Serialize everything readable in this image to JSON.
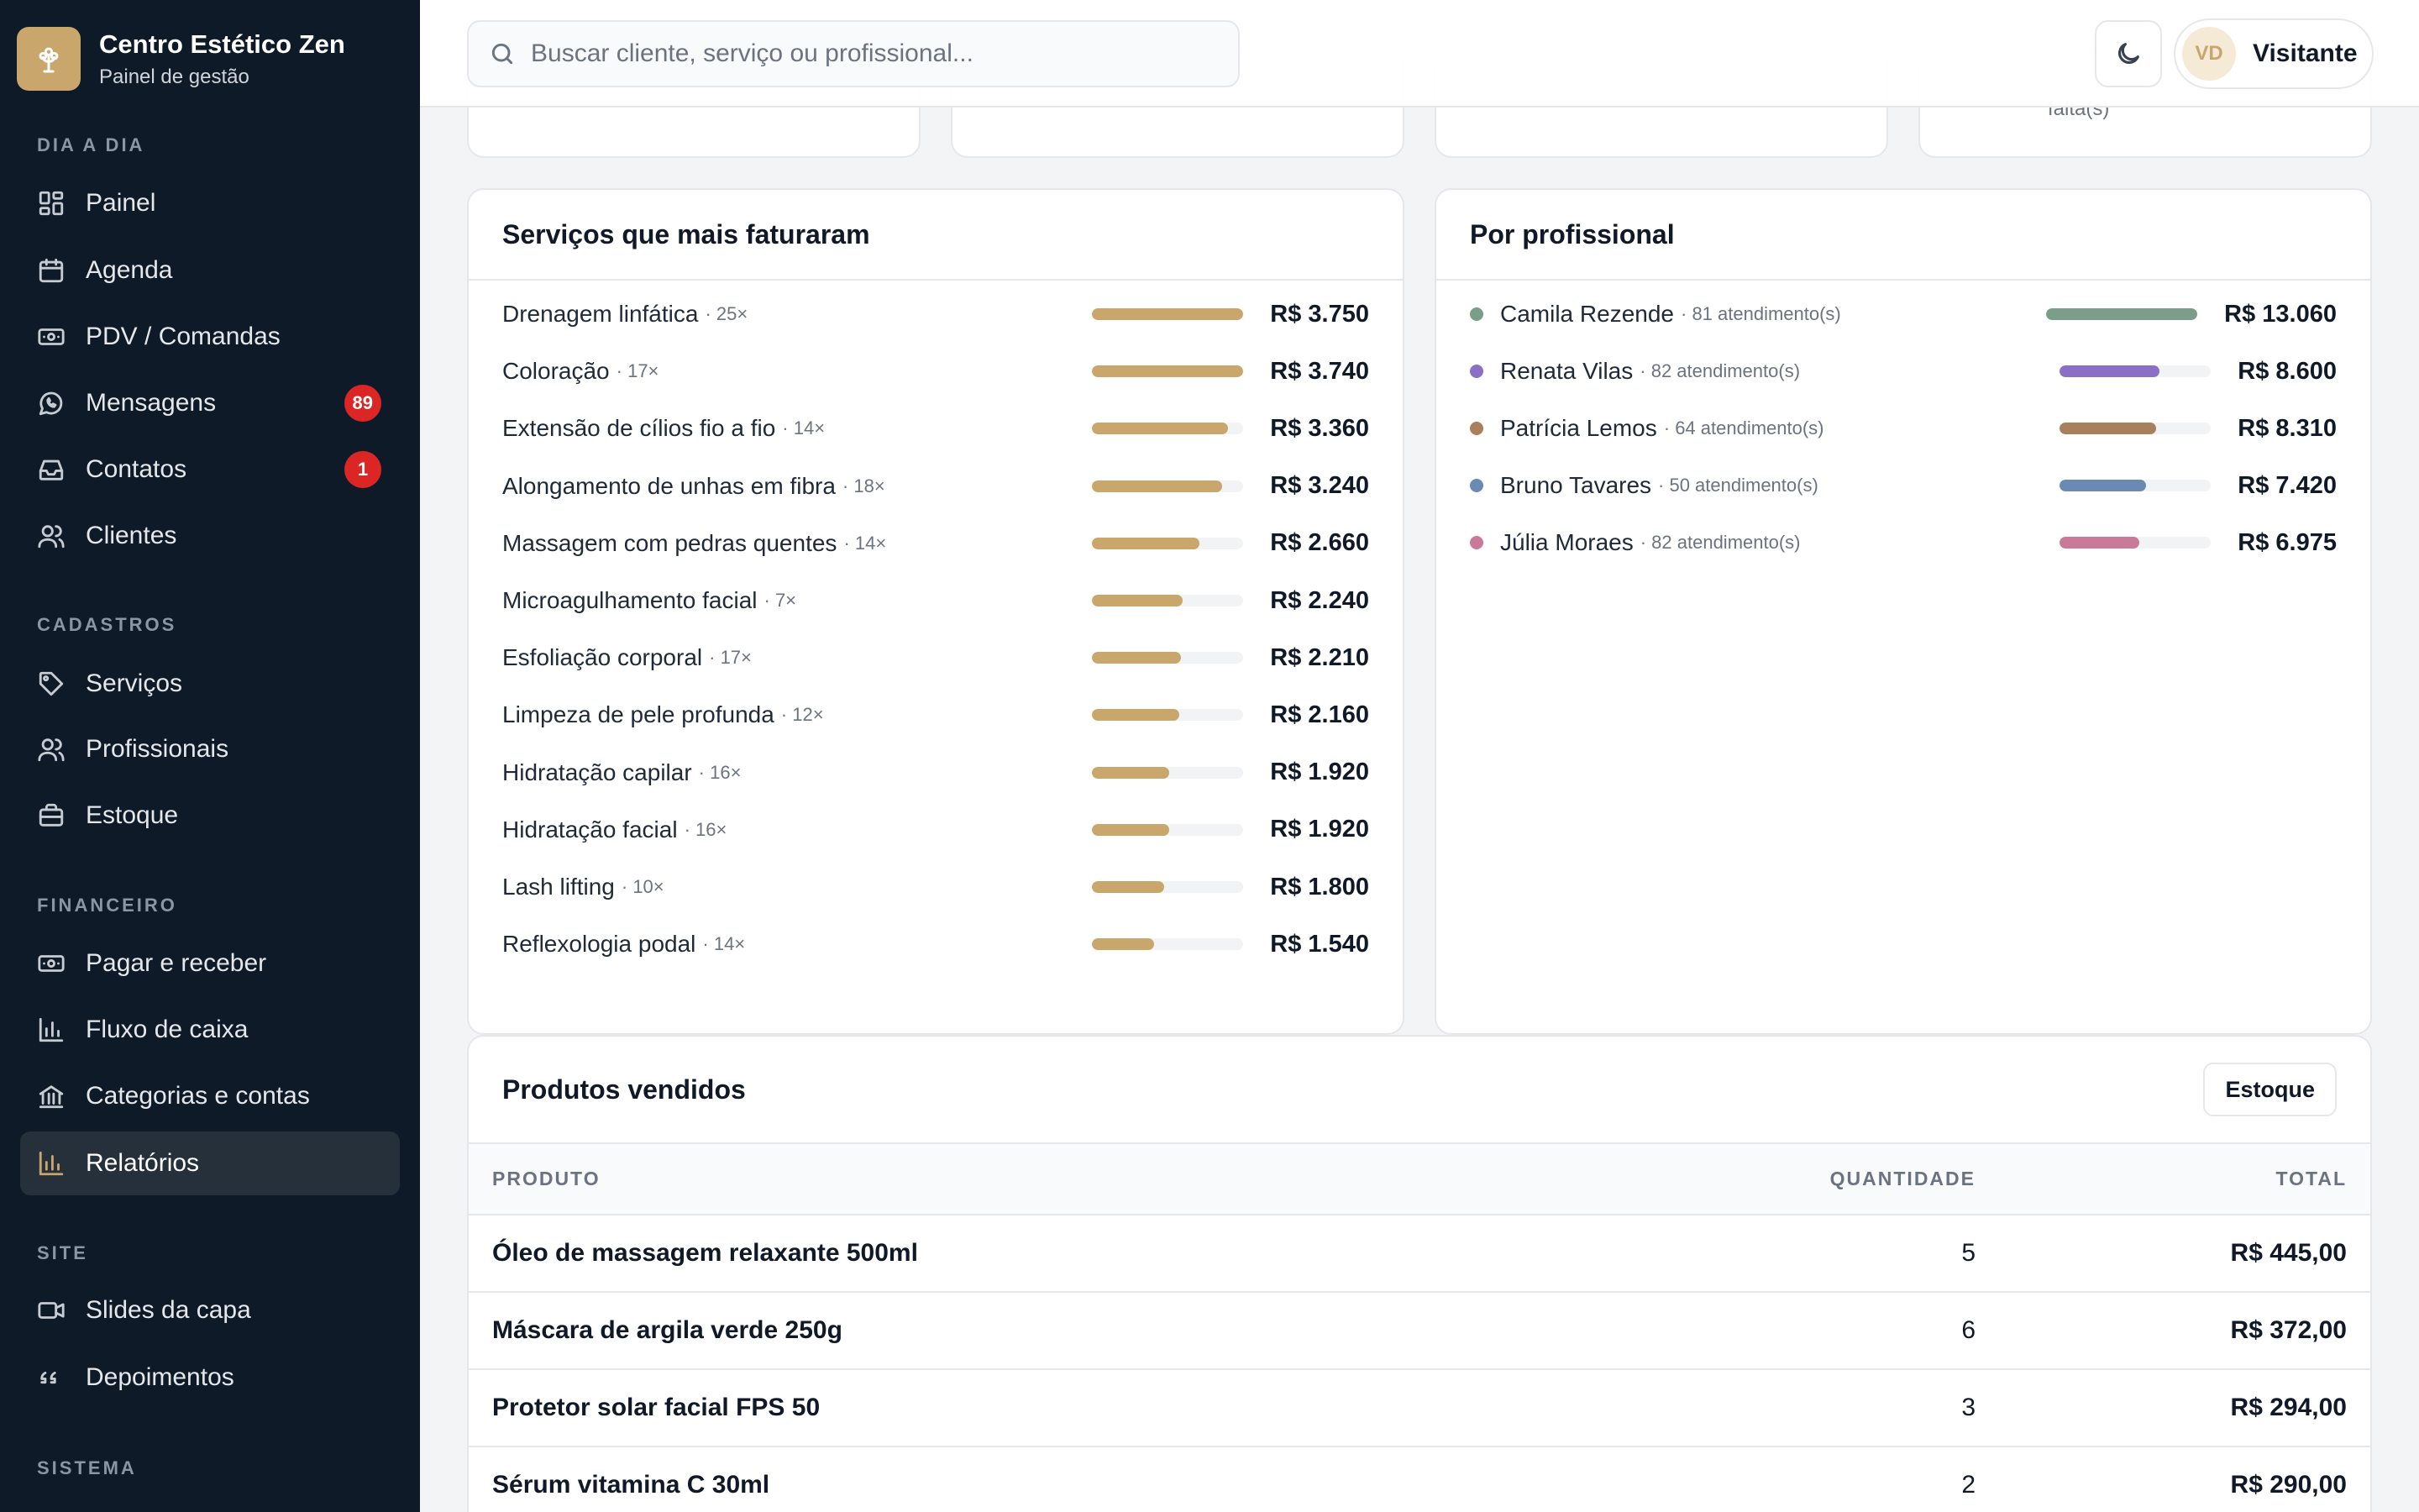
{
  "brand": {
    "title": "Centro Estético Zen",
    "subtitle": "Painel de gestão"
  },
  "sidebar": {
    "sections": [
      {
        "label": "DIA A DIA",
        "items": [
          {
            "label": "Painel",
            "icon": "layout-grid-icon"
          },
          {
            "label": "Agenda",
            "icon": "calendar-icon"
          },
          {
            "label": "PDV / Comandas",
            "icon": "banknote-icon"
          },
          {
            "label": "Mensagens",
            "icon": "whatsapp-icon",
            "badge": "89"
          },
          {
            "label": "Contatos",
            "icon": "inbox-icon",
            "badge": "1"
          },
          {
            "label": "Clientes",
            "icon": "users-icon"
          }
        ]
      },
      {
        "label": "CADASTROS",
        "items": [
          {
            "label": "Serviços",
            "icon": "tag-icon"
          },
          {
            "label": "Profissionais",
            "icon": "users-icon"
          },
          {
            "label": "Estoque",
            "icon": "briefcase-icon"
          }
        ]
      },
      {
        "label": "FINANCEIRO",
        "items": [
          {
            "label": "Pagar e receber",
            "icon": "banknote-icon"
          },
          {
            "label": "Fluxo de caixa",
            "icon": "bar-chart-icon"
          },
          {
            "label": "Categorias e contas",
            "icon": "bank-icon"
          },
          {
            "label": "Relatórios",
            "icon": "bar-chart-icon",
            "active": true
          }
        ]
      },
      {
        "label": "SITE",
        "items": [
          {
            "label": "Slides da capa",
            "icon": "video-icon"
          },
          {
            "label": "Depoimentos",
            "icon": "quote-icon"
          }
        ]
      },
      {
        "label": "SISTEMA",
        "items": []
      }
    ]
  },
  "topbar": {
    "search_placeholder": "Buscar cliente, serviço ou profissional...",
    "user_initials": "VD",
    "user_name": "Visitante"
  },
  "kpi_partial_text": "falta(s)",
  "services": {
    "title": "Serviços que mais faturaram",
    "items": [
      {
        "name": "Drenagem linfática",
        "count": "· 25×",
        "value": "R$ 3.750",
        "fraction": 1.0
      },
      {
        "name": "Coloração",
        "count": "· 17×",
        "value": "R$ 3.740",
        "fraction": 1.0
      },
      {
        "name": "Extensão de cílios fio a fio",
        "count": "· 14×",
        "value": "R$ 3.360",
        "fraction": 0.9
      },
      {
        "name": "Alongamento de unhas em fibra",
        "count": "· 18×",
        "value": "R$ 3.240",
        "fraction": 0.86
      },
      {
        "name": "Massagem com pedras quentes",
        "count": "· 14×",
        "value": "R$ 2.660",
        "fraction": 0.71
      },
      {
        "name": "Microagulhamento facial",
        "count": "· 7×",
        "value": "R$ 2.240",
        "fraction": 0.6
      },
      {
        "name": "Esfoliação corporal",
        "count": "· 17×",
        "value": "R$ 2.210",
        "fraction": 0.59
      },
      {
        "name": "Limpeza de pele profunda",
        "count": "· 12×",
        "value": "R$ 2.160",
        "fraction": 0.58
      },
      {
        "name": "Hidratação capilar",
        "count": "· 16×",
        "value": "R$ 1.920",
        "fraction": 0.51
      },
      {
        "name": "Hidratação facial",
        "count": "· 16×",
        "value": "R$ 1.920",
        "fraction": 0.51
      },
      {
        "name": "Lash lifting",
        "count": "· 10×",
        "value": "R$ 1.800",
        "fraction": 0.48
      },
      {
        "name": "Reflexologia podal",
        "count": "· 14×",
        "value": "R$ 1.540",
        "fraction": 0.41
      }
    ]
  },
  "professionals": {
    "title": "Por profissional",
    "items": [
      {
        "name": "Camila Rezende",
        "meta": "· 81 atendimento(s)",
        "value": "R$ 13.060",
        "fraction": 1.0,
        "color": "#7a9e8a"
      },
      {
        "name": "Renata Vilas",
        "meta": "· 82 atendimento(s)",
        "value": "R$ 8.600",
        "fraction": 0.66,
        "color": "#8b6fc6"
      },
      {
        "name": "Patrícia Lemos",
        "meta": "· 64 atendimento(s)",
        "value": "R$ 8.310",
        "fraction": 0.64,
        "color": "#a8805e"
      },
      {
        "name": "Bruno Tavares",
        "meta": "· 50 atendimento(s)",
        "value": "R$ 7.420",
        "fraction": 0.57,
        "color": "#6a8ab3"
      },
      {
        "name": "Júlia Moraes",
        "meta": "· 82 atendimento(s)",
        "value": "R$ 6.975",
        "fraction": 0.53,
        "color": "#c97a98"
      }
    ]
  },
  "products": {
    "title": "Produtos vendidos",
    "button": "Estoque",
    "columns": [
      "PRODUTO",
      "QUANTIDADE",
      "TOTAL"
    ],
    "rows": [
      {
        "product": "Óleo de massagem relaxante 500ml",
        "qty": "5",
        "total": "R$ 445,00"
      },
      {
        "product": "Máscara de argila verde 250g",
        "qty": "6",
        "total": "R$ 372,00"
      },
      {
        "product": "Protetor solar facial FPS 50",
        "qty": "3",
        "total": "R$ 294,00"
      },
      {
        "product": "Sérum vitamina C 30ml",
        "qty": "2",
        "total": "R$ 290,00"
      }
    ]
  },
  "colors": {
    "accent": "#c9a66b",
    "sidebar_bg": "#0e1a28",
    "badge": "#dc2626"
  }
}
